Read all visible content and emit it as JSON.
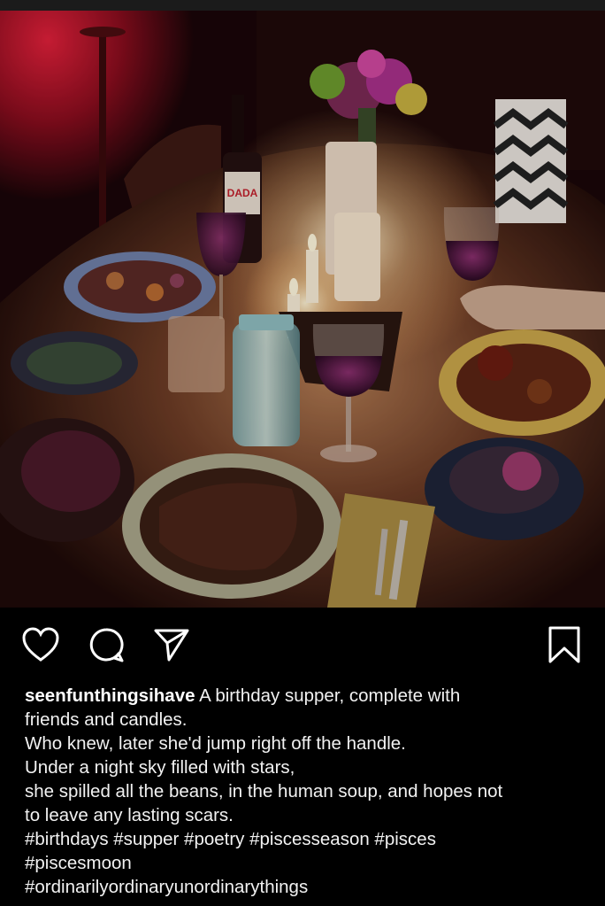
{
  "post": {
    "username": "seenfunthingsihave",
    "caption_lines": [
      "A birthday supper, complete with",
      "friends and candles.",
      "Who knew, later she'd jump right off the handle.",
      "Under a night sky filled with stars,",
      "she spilled all the beans, in the human soup, and hopes not",
      "to leave any lasting scars."
    ],
    "hashtag_lines": [
      "#birthdays #supper #poetry #piscesseason #pisces",
      "#piscesmoon",
      "#ordinarilyordinaryunordinarythings"
    ],
    "wine_label": "DADA"
  },
  "actions": {
    "icons": [
      "heart-icon",
      "comment-icon",
      "share-icon",
      "bookmark-icon"
    ]
  },
  "colors": {
    "background": "#000000",
    "text": "#f2f2f2",
    "wall_red": "#c0162a"
  }
}
